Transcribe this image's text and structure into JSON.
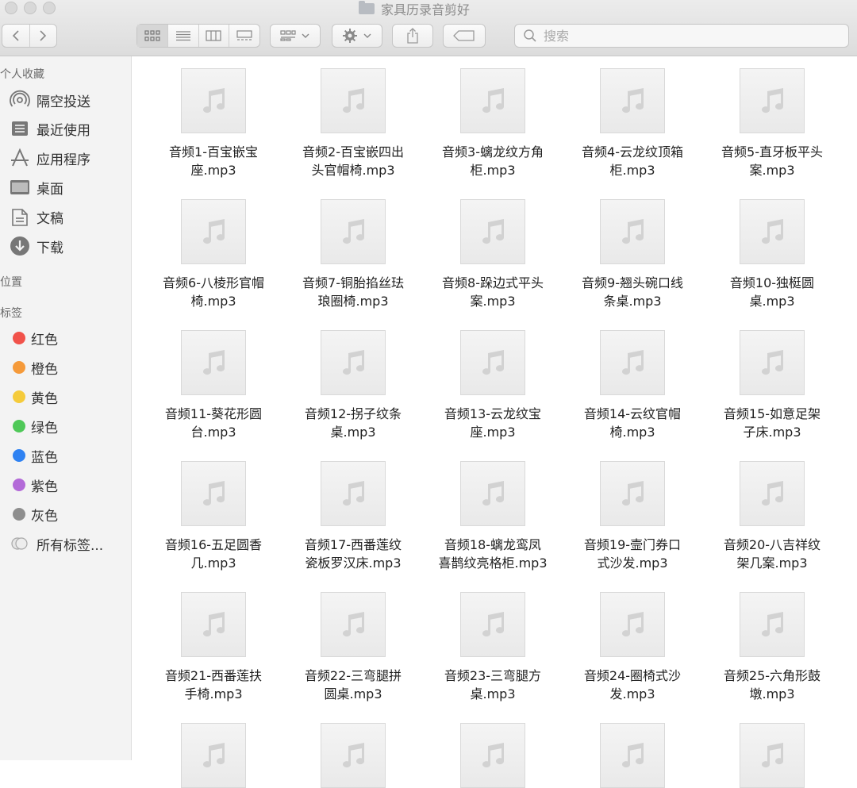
{
  "window": {
    "title": "家具历录音剪好"
  },
  "toolbar": {
    "search_placeholder": "搜索",
    "back_icon": "chevron-left-icon",
    "forward_icon": "chevron-right-icon"
  },
  "sidebar": {
    "favorites_header": "个人收藏",
    "favorites": [
      {
        "label": "隔空投送",
        "icon": "airdrop-icon"
      },
      {
        "label": "最近使用",
        "icon": "recents-icon"
      },
      {
        "label": "应用程序",
        "icon": "applications-icon"
      },
      {
        "label": "桌面",
        "icon": "desktop-icon"
      },
      {
        "label": "文稿",
        "icon": "documents-icon"
      },
      {
        "label": "下载",
        "icon": "downloads-icon"
      }
    ],
    "locations_header": "位置",
    "tags_header": "标签",
    "tags": [
      {
        "label": "红色",
        "color": "#f1524a"
      },
      {
        "label": "橙色",
        "color": "#f59a3a"
      },
      {
        "label": "黄色",
        "color": "#f5cb3b"
      },
      {
        "label": "绿色",
        "color": "#4fc858"
      },
      {
        "label": "蓝色",
        "color": "#2f82f2"
      },
      {
        "label": "紫色",
        "color": "#b36ad8"
      },
      {
        "label": "灰色",
        "color": "#8e8e8e"
      }
    ],
    "all_tags": "所有标签..."
  },
  "files": [
    {
      "line1": "音频1-百宝嵌宝",
      "line2": "座.mp3"
    },
    {
      "line1": "音频2-百宝嵌四出",
      "line2": "头官帽椅.mp3"
    },
    {
      "line1": "音频3-螭龙纹方角",
      "line2": "柜.mp3"
    },
    {
      "line1": "音频4-云龙纹顶箱",
      "line2": "柜.mp3"
    },
    {
      "line1": "音频5-直牙板平头",
      "line2": "案.mp3"
    },
    {
      "line1": "音频6-八棱形官帽",
      "line2": "椅.mp3"
    },
    {
      "line1": "音频7-铜胎掐丝珐",
      "line2": "琅圈椅.mp3"
    },
    {
      "line1": "音频8-跺边式平头",
      "line2": "案.mp3"
    },
    {
      "line1": "音频9-翘头碗口线",
      "line2": "条桌.mp3"
    },
    {
      "line1": "音频10-独梃圆",
      "line2": "桌.mp3"
    },
    {
      "line1": "音频11-葵花形圆",
      "line2": "台.mp3"
    },
    {
      "line1": "音频12-拐子纹条",
      "line2": "桌.mp3"
    },
    {
      "line1": "音频13-云龙纹宝",
      "line2": "座.mp3"
    },
    {
      "line1": "音频14-云纹官帽",
      "line2": "椅.mp3"
    },
    {
      "line1": "音频15-如意足架",
      "line2": "子床.mp3"
    },
    {
      "line1": "音频16-五足圆香",
      "line2": "几.mp3"
    },
    {
      "line1": "音频17-西番莲纹",
      "line2": "瓷板罗汉床.mp3"
    },
    {
      "line1": "音频18-螭龙鸾凤",
      "line2": "喜鹊纹亮格柜.mp3"
    },
    {
      "line1": "音频19-壸门券口",
      "line2": "式沙发.mp3"
    },
    {
      "line1": "音频20-八吉祥纹",
      "line2": "架几案.mp3"
    },
    {
      "line1": "音频21-西番莲扶",
      "line2": "手椅.mp3"
    },
    {
      "line1": "音频22-三弯腿拼",
      "line2": "圆桌.mp3"
    },
    {
      "line1": "音频23-三弯腿方",
      "line2": "桌.mp3"
    },
    {
      "line1": "音频24-圈椅式沙",
      "line2": "发.mp3"
    },
    {
      "line1": "音频25-六角形鼓",
      "line2": "墩.mp3"
    }
  ]
}
